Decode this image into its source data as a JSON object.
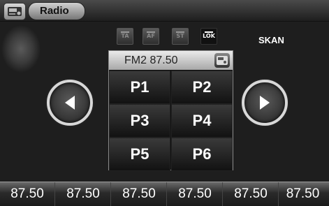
{
  "header": {
    "title": "Radio"
  },
  "indicators": [
    {
      "label": "TA",
      "active": false
    },
    {
      "label": "AF",
      "active": false
    },
    {
      "label": "ST",
      "active": false
    },
    {
      "label": "LOK",
      "active": true
    }
  ],
  "scan_label": "SKAN",
  "panel": {
    "frequency": "FM2 87.50",
    "presets": [
      "P1",
      "P2",
      "P3",
      "P4",
      "P5",
      "P6"
    ]
  },
  "bottom_frequencies": [
    "87.50",
    "87.50",
    "87.50",
    "87.50",
    "87.50",
    "87.50"
  ],
  "icons": {
    "home": "radio-home-icon",
    "prev": "arrow-left-icon",
    "next": "arrow-right-icon",
    "panel": "radio-device-icon"
  }
}
